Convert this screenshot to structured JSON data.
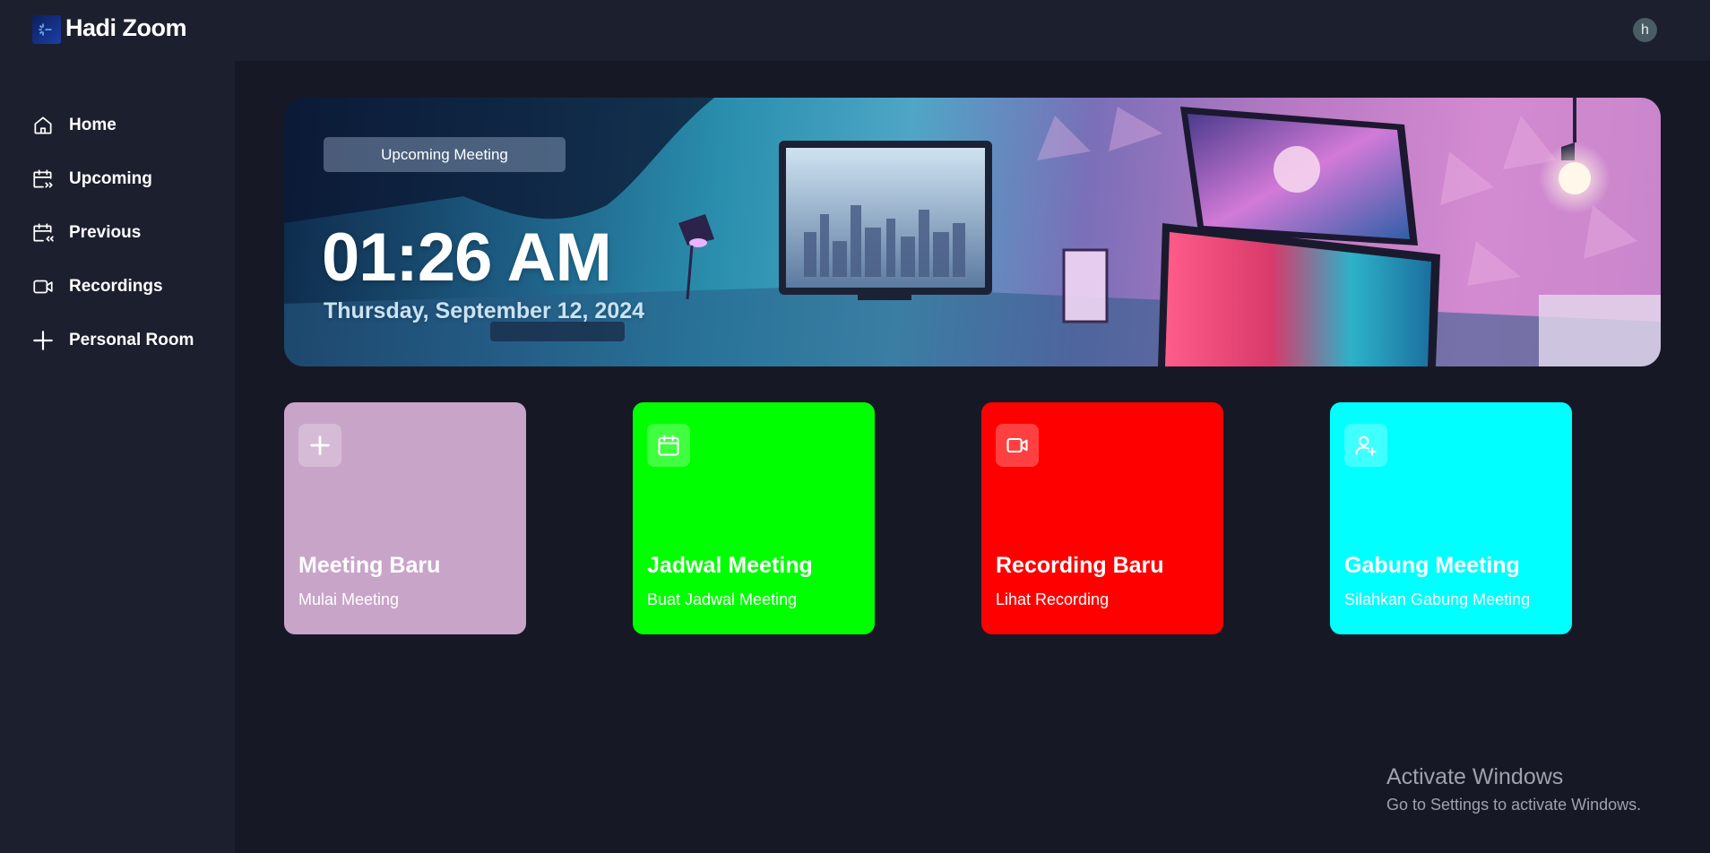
{
  "header": {
    "app_title": "Hadi Zoom",
    "avatar_initial": "h"
  },
  "sidebar": {
    "items": [
      {
        "label": "Home",
        "icon": "home-icon"
      },
      {
        "label": "Upcoming",
        "icon": "calendar-forward-icon"
      },
      {
        "label": "Previous",
        "icon": "calendar-back-icon"
      },
      {
        "label": "Recordings",
        "icon": "video-icon"
      },
      {
        "label": "Personal Room",
        "icon": "plus-icon"
      }
    ]
  },
  "hero": {
    "badge": "Upcoming Meeting",
    "time": "01:26 AM",
    "date": "Thursday, September 12, 2024"
  },
  "cards": [
    {
      "title": "Meeting Baru",
      "subtitle": "Mulai Meeting",
      "icon": "plus-icon",
      "color": "#c9a4c9"
    },
    {
      "title": "Jadwal Meeting",
      "subtitle": "Buat Jadwal Meeting",
      "icon": "calendar-icon",
      "color": "#00ff00"
    },
    {
      "title": "Recording Baru",
      "subtitle": "Lihat Recording",
      "icon": "video-icon",
      "color": "#ff0000"
    },
    {
      "title": "Gabung Meeting",
      "subtitle": "Silahkan Gabung Meeting",
      "icon": "user-plus-icon",
      "color": "#00ffff"
    }
  ],
  "watermark": {
    "line1": "Activate Windows",
    "line2": "Go to Settings to activate Windows."
  },
  "colors": {
    "background": "#161925",
    "panel": "#1c1f2e"
  }
}
